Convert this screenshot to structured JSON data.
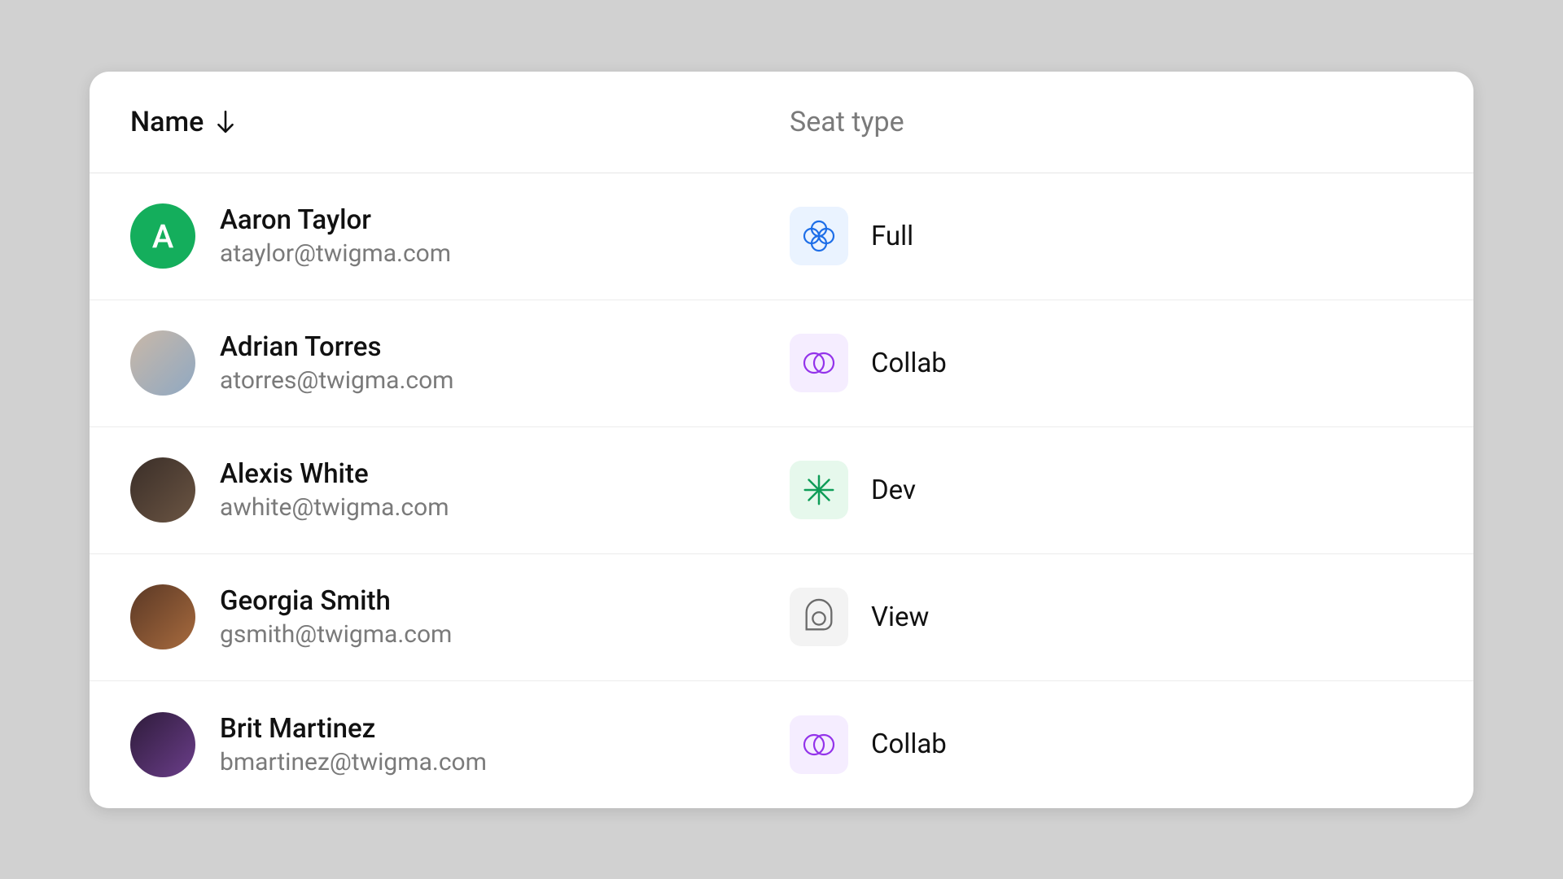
{
  "columns": {
    "name": "Name",
    "seat": "Seat type"
  },
  "sort": {
    "column": "name",
    "direction": "asc"
  },
  "seat_types": {
    "full": "Full",
    "collab": "Collab",
    "dev": "Dev",
    "view": "View"
  },
  "users": [
    {
      "name": "Aaron Taylor",
      "email": "ataylor@twigma.com",
      "avatar_type": "letter",
      "avatar_letter": "A",
      "avatar_color": "#14ae5c",
      "seat": "full"
    },
    {
      "name": "Adrian Torres",
      "email": "atorres@twigma.com",
      "avatar_type": "photo",
      "seat": "collab"
    },
    {
      "name": "Alexis White",
      "email": "awhite@twigma.com",
      "avatar_type": "photo",
      "seat": "dev"
    },
    {
      "name": "Georgia Smith",
      "email": "gsmith@twigma.com",
      "avatar_type": "photo",
      "seat": "view"
    },
    {
      "name": "Brit Martinez",
      "email": "bmartinez@twigma.com",
      "avatar_type": "photo",
      "seat": "collab"
    }
  ]
}
